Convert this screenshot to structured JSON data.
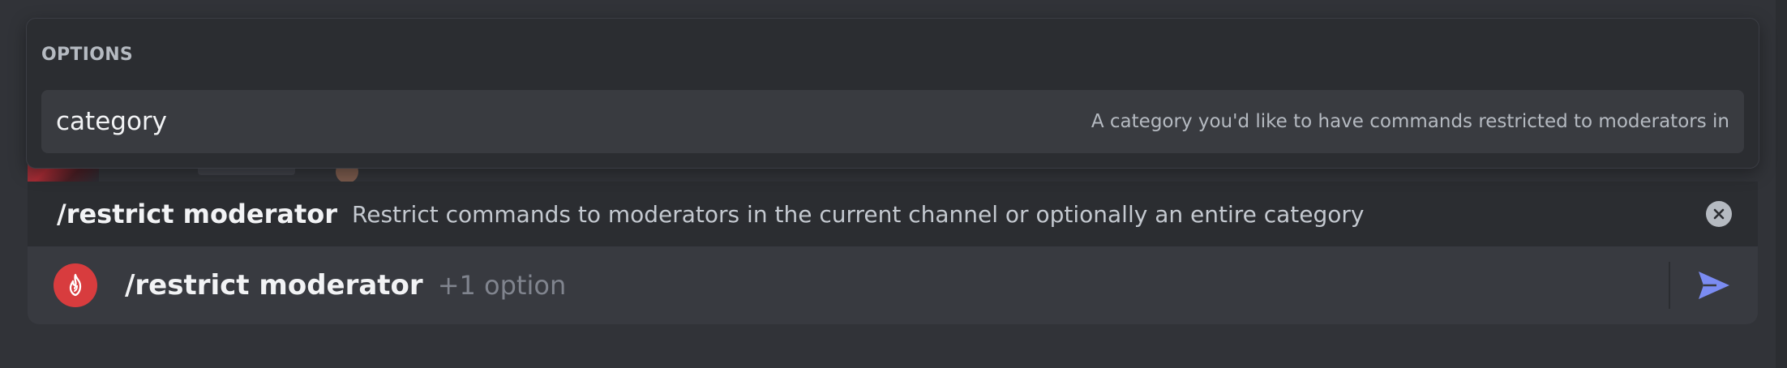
{
  "options_popup": {
    "header": "OPTIONS",
    "items": [
      {
        "name": "category",
        "description": "A category you'd like to have commands restricted to moderators in"
      }
    ]
  },
  "command_bar": {
    "name": "/restrict moderator",
    "description": "Restrict commands to moderators in the current channel or optionally an entire category",
    "close_icon": "close-circle-icon"
  },
  "composer": {
    "app_icon": "flame-app-icon",
    "app_color": "#d83c3e",
    "command": "/restrict moderator",
    "options_hint": "+1 option",
    "send_icon": "send-icon",
    "send_color": "#7b8cf2"
  },
  "colors": {
    "background": "#313338",
    "popup": "#2b2d31",
    "option_row": "#393b40",
    "composer": "#383a40"
  }
}
